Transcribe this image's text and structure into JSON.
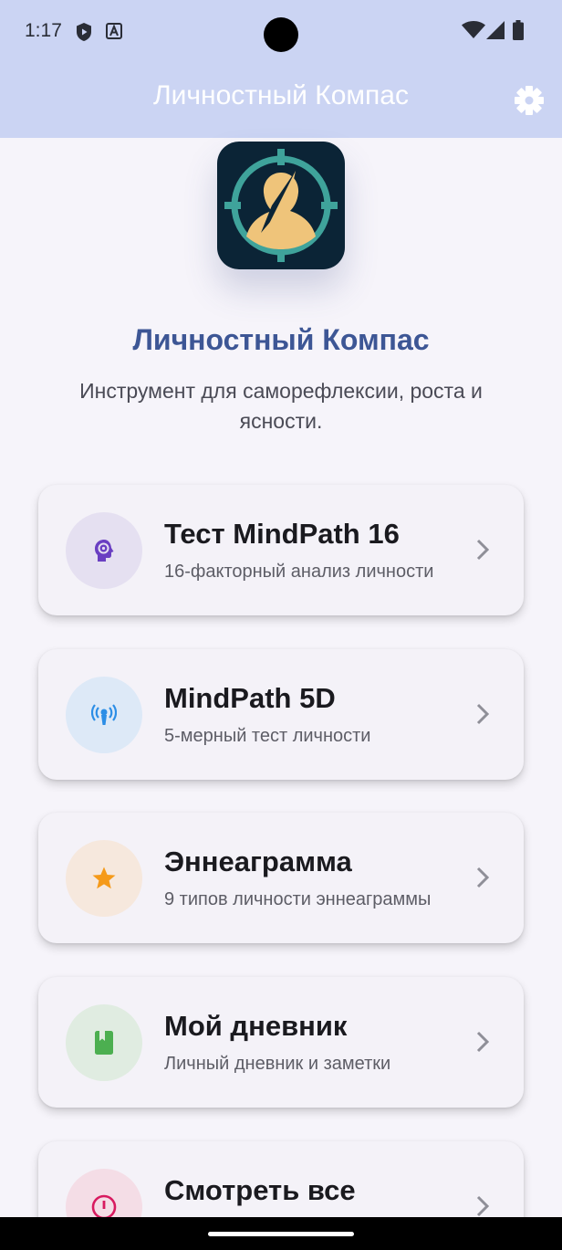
{
  "status_bar": {
    "time": "1:17",
    "icons": [
      "shield-play-icon",
      "font-a-icon",
      "wifi-icon",
      "signal-icon",
      "battery-icon"
    ]
  },
  "app_bar": {
    "title": "Личностный Компас",
    "settings_icon": "gear-icon"
  },
  "hero": {
    "logo_icon": "compass-person-logo",
    "title": "Личностный Компас",
    "subtitle": "Инструмент для саморефлексии, роста и ясности."
  },
  "cards": [
    {
      "title": "Тест MindPath 16",
      "subtitle": "16-факторный анализ личности",
      "icon": "brain-gear-icon",
      "icon_color": "#6a3fc2",
      "circle_color": "#e5e0f1"
    },
    {
      "title": "MindPath 5D",
      "subtitle": "5-мерный тест личности",
      "icon": "broadcast-person-icon",
      "icon_color": "#2c8ee6",
      "circle_color": "#dde9f7"
    },
    {
      "title": "Эннеаграмма",
      "subtitle": "9 типов личности эннеаграммы",
      "icon": "star-icon",
      "icon_color": "#f59a1a",
      "circle_color": "#f6e8dd"
    },
    {
      "title": "Мой дневник",
      "subtitle": "Личный дневник и заметки",
      "icon": "book-icon",
      "icon_color": "#4caf50",
      "circle_color": "#e0ece1"
    },
    {
      "title": "Смотреть все",
      "subtitle": "",
      "icon": "info-circle-icon",
      "icon_color": "#d81b60",
      "circle_color": "#f4dde6"
    }
  ],
  "colors": {
    "header_bg": "#cbd4f3",
    "page_bg": "#f6f4fa",
    "accent": "#3d5695"
  }
}
